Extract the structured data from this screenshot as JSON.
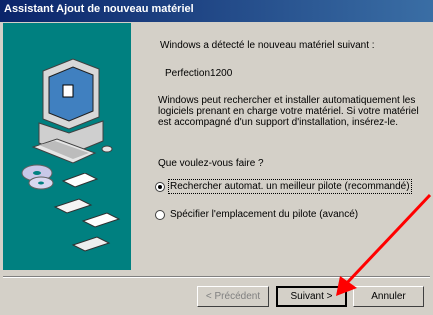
{
  "window": {
    "title": "Assistant Ajout de nouveau matériel"
  },
  "content": {
    "detected_text": "Windows a détecté le nouveau matériel suivant :",
    "device_name": "Perfection1200",
    "paragraph": "Windows peut rechercher et installer automatiquement les logiciels prenant en charge votre matériel. Si votre matériel est accompagné d'un support d'installation, insérez-le.",
    "question": "Que voulez-vous faire ?",
    "options": [
      {
        "label": "Rechercher automat. un meilleur pilote (recommandé)",
        "selected": true
      },
      {
        "label": "Spécifier l'emplacement du pilote (avancé)",
        "selected": false
      }
    ]
  },
  "buttons": {
    "back": "< Précédent",
    "next": "Suivant >",
    "cancel": "Annuler"
  },
  "colors": {
    "title_bar": "#0a246a",
    "side_panel": "#008080",
    "dialog_bg": "#d4d0c8",
    "annotation_arrow": "#ff0000"
  },
  "icons": [
    "computer-wizard-icon",
    "cd-disc-icon",
    "floppy-disk-icon",
    "annotation-arrow"
  ]
}
